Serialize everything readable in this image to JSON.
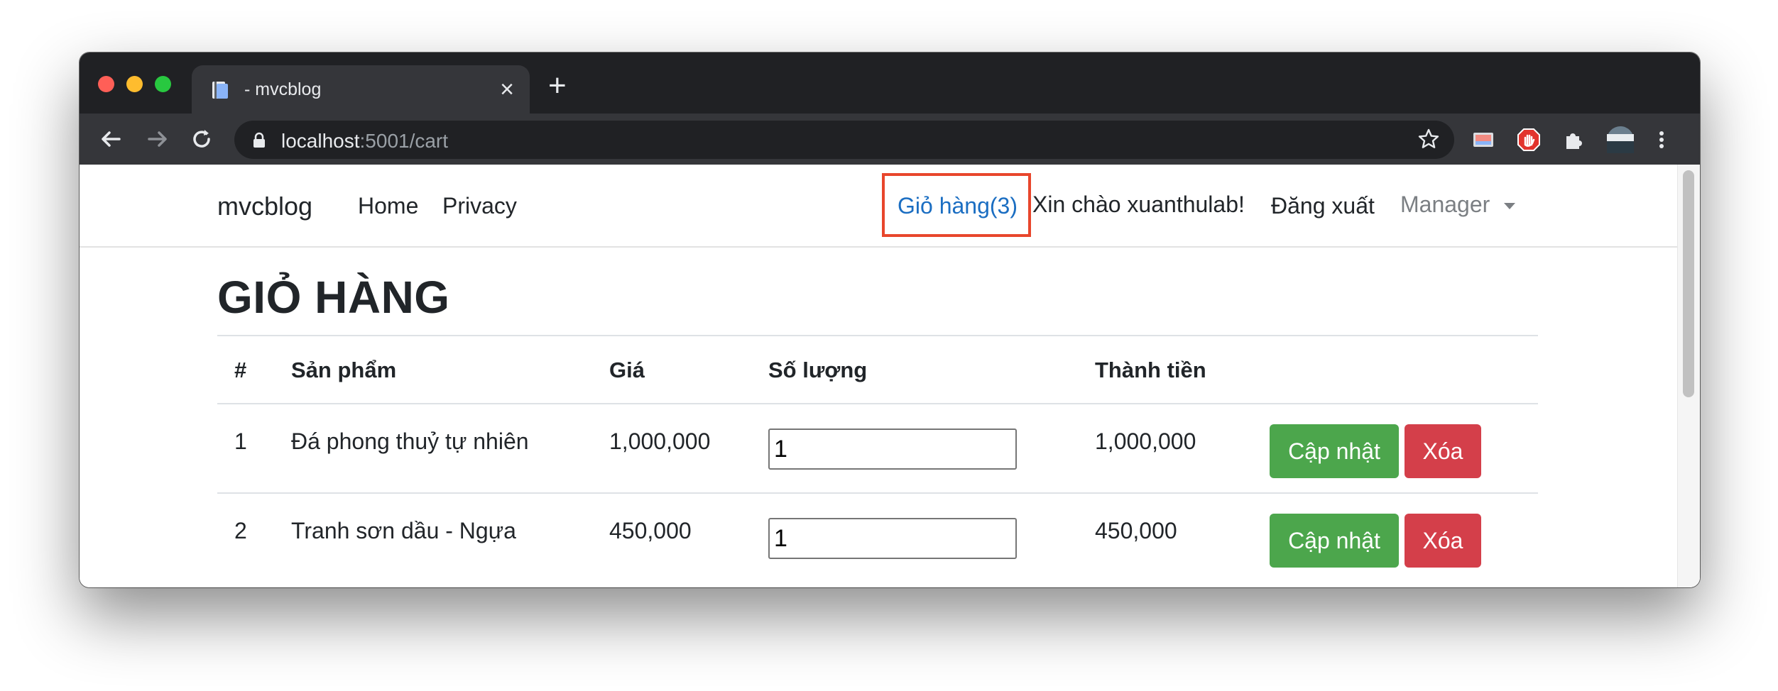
{
  "browser": {
    "tab_title": "- mvcblog",
    "close_tab_glyph": "×",
    "new_tab_glyph": "+",
    "url_host": "localhost",
    "url_rest": ":5001/cart"
  },
  "navbar": {
    "brand": "mvcblog",
    "links": [
      "Home",
      "Privacy"
    ],
    "cart": "Giỏ hàng(3)",
    "greeting": "Xin chào xuanthulab!",
    "logout": "Đăng xuất",
    "manager": "Manager"
  },
  "page": {
    "title": "GIỎ HÀNG"
  },
  "table": {
    "headers": [
      "#",
      "Sản phẩm",
      "Giá",
      "Số lượng",
      "Thành tiền"
    ],
    "rows": [
      {
        "index": "1",
        "product": "Đá phong thuỷ tự nhiên",
        "price": "1,000,000",
        "quantity": "1",
        "total": "1,000,000"
      },
      {
        "index": "2",
        "product": "Tranh sơn dầu - Ngựa",
        "price": "450,000",
        "quantity": "1",
        "total": "450,000"
      }
    ],
    "update_label": "Cập nhật",
    "delete_label": "Xóa"
  },
  "colors": {
    "link_blue": "#1b6ec2",
    "highlight_box": "#e8462c",
    "update_green": "#4ca64c",
    "delete_red": "#d43f4a"
  },
  "icons": [
    "favicon-icon",
    "close-tab-icon",
    "new-tab-icon",
    "back-icon",
    "forward-icon",
    "reload-icon",
    "lock-icon",
    "star-icon",
    "cast-icon",
    "adblock-icon",
    "puzzle-icon",
    "profile-avatar",
    "menu-icon"
  ]
}
